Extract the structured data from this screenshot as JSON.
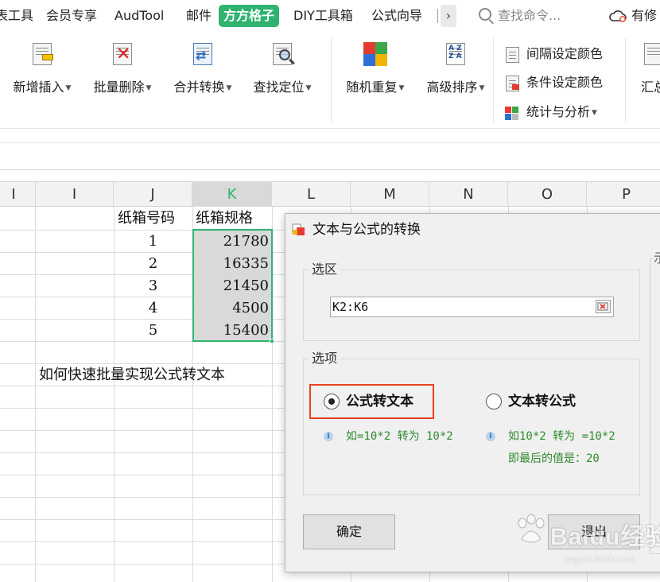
{
  "tabs": [
    {
      "label": "表工具"
    },
    {
      "label": "会员专享"
    },
    {
      "label": "AudTool"
    },
    {
      "label": "邮件"
    },
    {
      "label": "方方格子"
    },
    {
      "label": "DIY工具箱"
    },
    {
      "label": "公式向导"
    }
  ],
  "tab_more": "›",
  "search": {
    "placeholder": "查找命令..."
  },
  "cloud": {
    "label": "有修"
  },
  "ribbon": {
    "buttons": [
      {
        "label": "新增插入"
      },
      {
        "label": "批量删除"
      },
      {
        "label": "合并转换"
      },
      {
        "label": "查找定位"
      },
      {
        "label": "随机重复"
      },
      {
        "label": "高级排序"
      }
    ],
    "small": [
      {
        "label": "间隔设定颜色"
      },
      {
        "label": "条件设定颜色"
      },
      {
        "label": "统计与分析"
      }
    ],
    "cut": {
      "label": "汇总"
    }
  },
  "sheet": {
    "columns": [
      "I",
      "I",
      "J",
      "K",
      "L",
      "M",
      "N",
      "O",
      "P"
    ],
    "selected_column": "K",
    "headers": {
      "j": "纸箱号码",
      "k": "纸箱规格"
    },
    "rows": [
      {
        "j": "1",
        "k": "21780"
      },
      {
        "j": "2",
        "k": "16335"
      },
      {
        "j": "3",
        "k": "21450"
      },
      {
        "j": "4",
        "k": "4500"
      },
      {
        "j": "5",
        "k": "15400"
      }
    ],
    "note": "如何快速批量实现公式转文本"
  },
  "dialog": {
    "title": "文本与公式的转换",
    "range_group": "选区",
    "range_value": "K2:K6",
    "options_group": "选项",
    "option_formula_to_text": "公式转文本",
    "option_text_to_formula": "文本转公式",
    "selected_option": "formula_to_text",
    "hint_left": "如=10*2 转为 10*2",
    "hint_right_1": "如10*2 转为 =10*2",
    "hint_right_2": "即最后的值是：20",
    "ok_label": "确定",
    "exit_label": "退出",
    "right_panel_label": "示"
  },
  "watermark": {
    "text": "Baidu经验",
    "sub": "jingyan.baidu.com"
  },
  "colors": {
    "accent": "#2fb36f",
    "highlight": "#e8421e",
    "hint": "#2f8a2f"
  }
}
